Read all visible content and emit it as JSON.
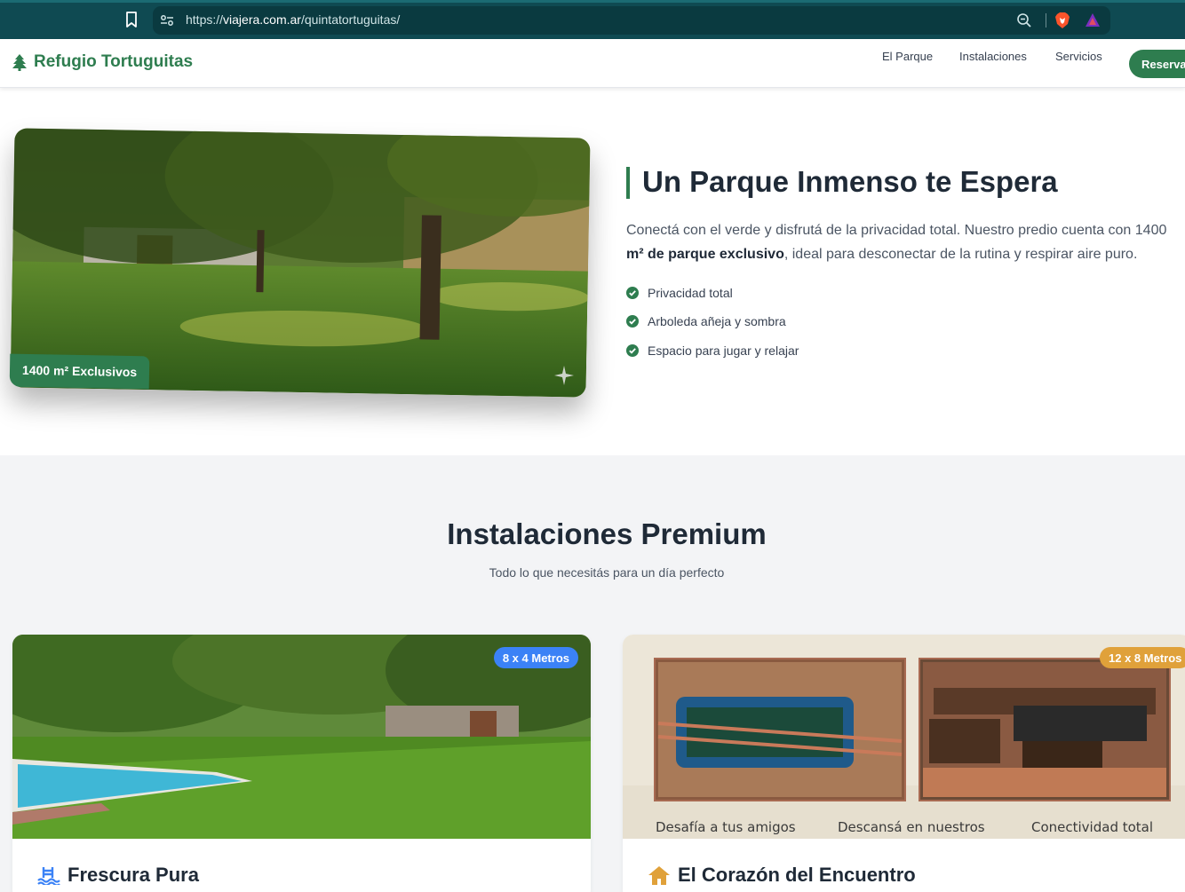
{
  "browser": {
    "url_prefix": "https://",
    "url_domain": "viajera.com.ar",
    "url_path": "/quintatortuguitas/"
  },
  "nav": {
    "brand": "Refugio Tortuguitas",
    "links": [
      "El Parque",
      "Instalaciones",
      "Servicios"
    ],
    "cta": "Reservar"
  },
  "park": {
    "badge": "1400 m² Exclusivos",
    "title": "Un Parque Inmenso te Espera",
    "desc_line1": "Conectá con el verde y disfrutá de la privacidad total. Nuestro predio cuenta con 1400",
    "desc_bold": "m² de parque exclusivo",
    "desc_rest": ", ideal para desconectar de la rutina y respirar aire puro.",
    "features": [
      "Privacidad total",
      "Arboleda añeja y sombra",
      "Espacio para jugar y relajar"
    ]
  },
  "installations": {
    "title": "Instalaciones Premium",
    "subtitle": "Todo lo que necesitás para un día perfecto",
    "cards": [
      {
        "badge": "8 x 4 Metros",
        "title": "Frescura Pura"
      },
      {
        "badge": "12 x 8 Metros",
        "title": "El Corazón del Encuentro",
        "captions": [
          "Desafía a tus amigos",
          "Descansá en nuestros",
          "Conectividad total"
        ]
      }
    ]
  },
  "colors": {
    "browser_bar": "#0f4a52",
    "brand_green": "#2e7d4f",
    "badge_blue": "#3b82f6",
    "badge_amber": "#e0a13a",
    "section_bg": "#f3f4f6"
  },
  "icons": [
    "bookmark-icon",
    "site-settings-icon",
    "zoom-icon",
    "brave-icon",
    "rewards-icon",
    "tree-icon",
    "check-icon",
    "sparkle-icon",
    "pool-icon",
    "house-icon"
  ]
}
